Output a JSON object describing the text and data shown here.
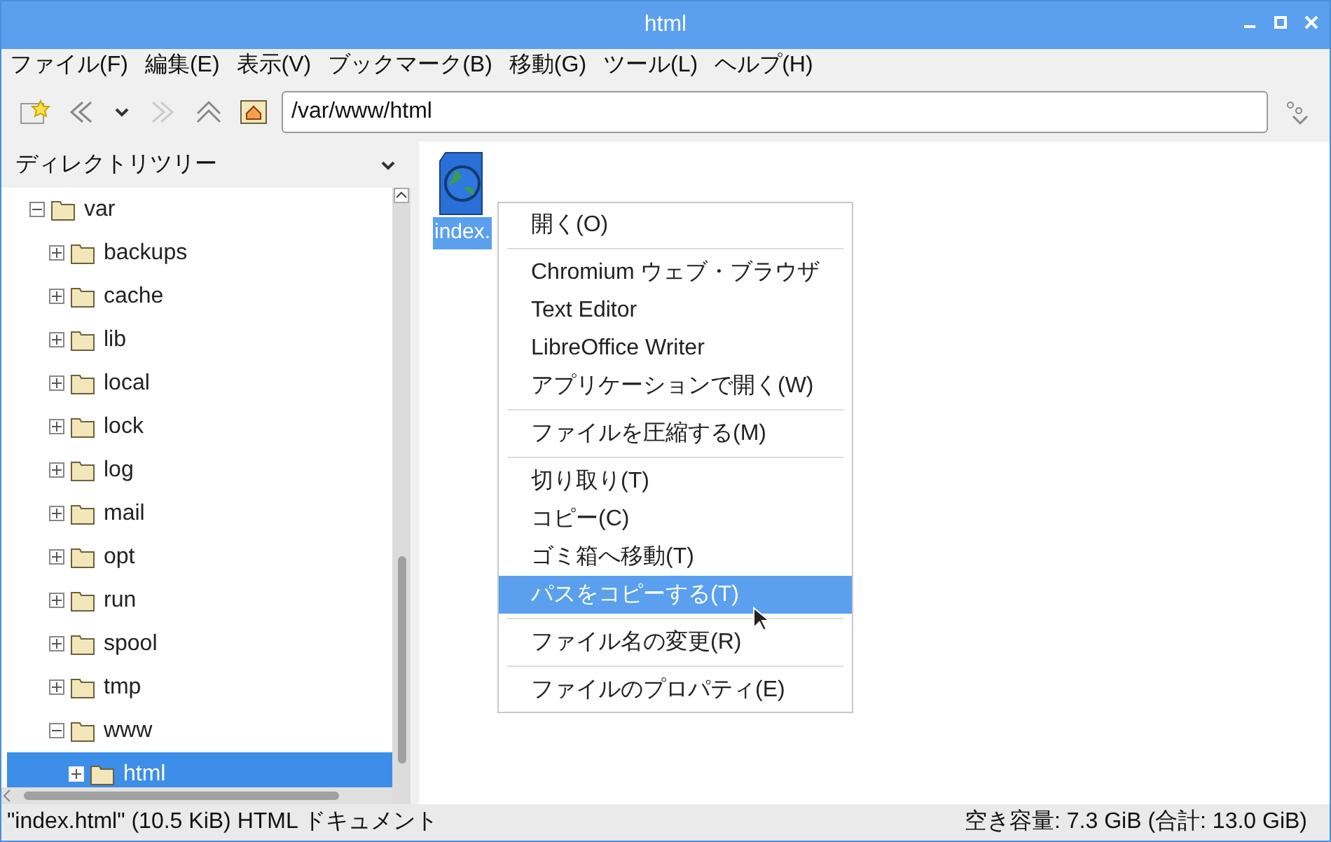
{
  "window": {
    "title": "html"
  },
  "menu_bar": [
    "ファイル(F)",
    "編集(E)",
    "表示(V)",
    "ブックマーク(B)",
    "移動(G)",
    "ツール(L)",
    "ヘルプ(H)"
  ],
  "toolbar": {
    "path": "/var/www/html"
  },
  "sidebar": {
    "title": "ディレクトリツリー",
    "tree": [
      {
        "name": "var",
        "expanded": true,
        "selected": false,
        "children": [
          {
            "name": "backups",
            "expanded": false,
            "selected": false
          },
          {
            "name": "cache",
            "expanded": false,
            "selected": false
          },
          {
            "name": "lib",
            "expanded": false,
            "selected": false
          },
          {
            "name": "local",
            "expanded": false,
            "selected": false
          },
          {
            "name": "lock",
            "expanded": false,
            "selected": false
          },
          {
            "name": "log",
            "expanded": false,
            "selected": false
          },
          {
            "name": "mail",
            "expanded": false,
            "selected": false
          },
          {
            "name": "opt",
            "expanded": false,
            "selected": false
          },
          {
            "name": "run",
            "expanded": false,
            "selected": false
          },
          {
            "name": "spool",
            "expanded": false,
            "selected": false
          },
          {
            "name": "tmp",
            "expanded": false,
            "selected": false
          },
          {
            "name": "www",
            "expanded": true,
            "selected": false,
            "children": [
              {
                "name": "html",
                "expanded": false,
                "selected": true
              }
            ]
          }
        ]
      }
    ]
  },
  "files": [
    {
      "name": "index.",
      "selected": true
    }
  ],
  "context_menu": [
    [
      {
        "label": "開く(O)",
        "selected": false
      }
    ],
    [
      {
        "label": "Chromium ウェブ・ブラウザ",
        "selected": false
      },
      {
        "label": "Text Editor",
        "selected": false
      },
      {
        "label": "LibreOffice Writer",
        "selected": false
      },
      {
        "label": "アプリケーションで開く(W)",
        "selected": false
      }
    ],
    [
      {
        "label": "ファイルを圧縮する(M)",
        "selected": false
      }
    ],
    [
      {
        "label": "切り取り(T)",
        "selected": false
      },
      {
        "label": "コピー(C)",
        "selected": false
      },
      {
        "label": "ゴミ箱へ移動(T)",
        "selected": false
      },
      {
        "label": "パスをコピーする(T)",
        "selected": true
      }
    ],
    [
      {
        "label": "ファイル名の変更(R)",
        "selected": false
      }
    ],
    [
      {
        "label": "ファイルのプロパティ(E)",
        "selected": false
      }
    ]
  ],
  "status_bar": {
    "left": "\"index.html\" (10.5 KiB) HTML ドキュメント",
    "right": "空き容量: 7.3 GiB (合計: 13.0 GiB)"
  }
}
